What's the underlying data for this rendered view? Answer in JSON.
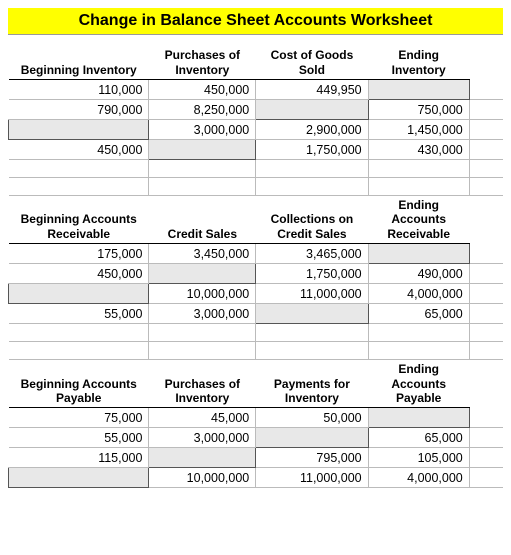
{
  "title": "Change in Balance Sheet Accounts Worksheet",
  "sections": [
    {
      "headers": [
        "Beginning Inventory",
        "Purchases of Inventory",
        "Cost of Goods Sold",
        "Ending Inventory"
      ],
      "rows": [
        {
          "c": [
            "110,000",
            "450,000",
            "449,950",
            ""
          ],
          "inp": [
            3
          ]
        },
        {
          "c": [
            "790,000",
            "8,250,000",
            "",
            "750,000"
          ],
          "inp": [
            2
          ]
        },
        {
          "c": [
            "",
            "3,000,000",
            "2,900,000",
            "1,450,000"
          ],
          "inp": [
            0
          ]
        },
        {
          "c": [
            "450,000",
            "",
            "1,750,000",
            "430,000"
          ],
          "inp": [
            1
          ]
        }
      ]
    },
    {
      "headers": [
        "Beginning Accounts Receivable",
        "Credit Sales",
        "Collections on Credit Sales",
        "Ending Accounts Receivable"
      ],
      "rows": [
        {
          "c": [
            "175,000",
            "3,450,000",
            "3,465,000",
            ""
          ],
          "inp": [
            3
          ]
        },
        {
          "c": [
            "450,000",
            "",
            "1,750,000",
            "490,000"
          ],
          "inp": [
            1
          ]
        },
        {
          "c": [
            "",
            "10,000,000",
            "11,000,000",
            "4,000,000"
          ],
          "inp": [
            0
          ]
        },
        {
          "c": [
            "55,000",
            "3,000,000",
            "",
            "65,000"
          ],
          "inp": [
            2
          ]
        }
      ]
    },
    {
      "headers": [
        "Beginning Accounts Payable",
        "Purchases of Inventory",
        "Payments for Inventory",
        "Ending Accounts Payable"
      ],
      "rows": [
        {
          "c": [
            "75,000",
            "45,000",
            "50,000",
            ""
          ],
          "inp": [
            3
          ]
        },
        {
          "c": [
            "55,000",
            "3,000,000",
            "",
            "65,000"
          ],
          "inp": [
            2
          ]
        },
        {
          "c": [
            "115,000",
            "",
            "795,000",
            "105,000"
          ],
          "inp": [
            1
          ]
        },
        {
          "c": [
            "",
            "10,000,000",
            "11,000,000",
            "4,000,000"
          ],
          "inp": [
            0
          ]
        }
      ]
    }
  ],
  "chart_data": {
    "type": "table",
    "title": "Change in Balance Sheet Accounts Worksheet",
    "tables": [
      {
        "columns": [
          "Beginning Inventory",
          "Purchases of Inventory",
          "Cost of Goods Sold",
          "Ending Inventory"
        ],
        "data": [
          [
            110000,
            450000,
            449950,
            null
          ],
          [
            790000,
            8250000,
            null,
            750000
          ],
          [
            null,
            3000000,
            2900000,
            1450000
          ],
          [
            450000,
            null,
            1750000,
            430000
          ]
        ]
      },
      {
        "columns": [
          "Beginning Accounts Receivable",
          "Credit Sales",
          "Collections on Credit Sales",
          "Ending Accounts Receivable"
        ],
        "data": [
          [
            175000,
            3450000,
            3465000,
            null
          ],
          [
            450000,
            null,
            1750000,
            490000
          ],
          [
            null,
            10000000,
            11000000,
            4000000
          ],
          [
            55000,
            3000000,
            null,
            65000
          ]
        ]
      },
      {
        "columns": [
          "Beginning Accounts Payable",
          "Purchases of Inventory",
          "Payments for Inventory",
          "Ending Accounts Payable"
        ],
        "data": [
          [
            75000,
            45000,
            50000,
            null
          ],
          [
            55000,
            3000000,
            null,
            65000
          ],
          [
            115000,
            null,
            795000,
            105000
          ],
          [
            null,
            10000000,
            11000000,
            4000000
          ]
        ]
      }
    ]
  }
}
